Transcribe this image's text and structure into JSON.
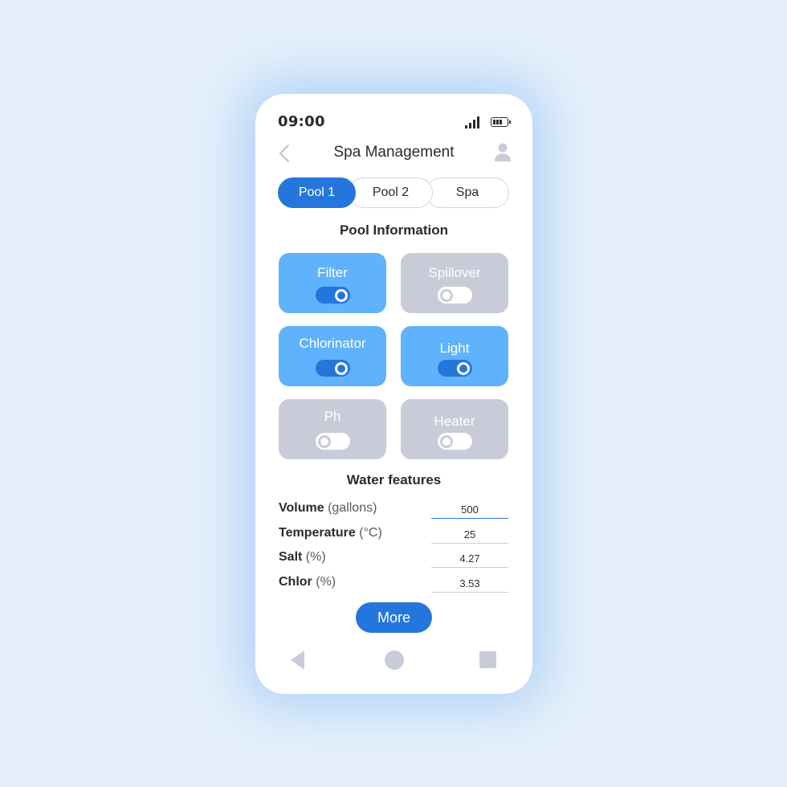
{
  "status_bar": {
    "time": "09:00",
    "icons": [
      "signal-icon",
      "battery-icon"
    ]
  },
  "header": {
    "title": "Spa Management",
    "back_icon": "chevron-left-icon",
    "profile_icon": "user-icon"
  },
  "tabs": [
    {
      "label": "Pool 1",
      "active": true
    },
    {
      "label": "Pool 2",
      "active": false
    },
    {
      "label": "Spa",
      "active": false
    }
  ],
  "pool_information": {
    "title": "Pool Information",
    "devices": [
      {
        "label": "Filter",
        "on": true
      },
      {
        "label": "Spillover",
        "on": false
      },
      {
        "label": "Chlorinator",
        "on": true
      },
      {
        "label": "Light",
        "on": true
      },
      {
        "label": "Ph",
        "on": false
      },
      {
        "label": "Heater",
        "on": false
      }
    ]
  },
  "water_features": {
    "title": "Water features",
    "rows": [
      {
        "label": "Volume",
        "unit": "(gallons)",
        "value": "500"
      },
      {
        "label": "Temperature",
        "unit": "(°C)",
        "value": "25"
      },
      {
        "label": "Salt",
        "unit": "(%)",
        "value": "4.27"
      },
      {
        "label": "Chlor",
        "unit": "(%)",
        "value": "3.53"
      }
    ]
  },
  "more_button": {
    "label": "More"
  },
  "nav_bar": {
    "icons": [
      "nav-back-icon",
      "nav-home-icon",
      "nav-recent-apps-icon"
    ]
  },
  "colors": {
    "accent": "#2476dd",
    "card_on": "#5fb2fc",
    "card_off": "#c9ccd8",
    "background": "#e5f0fa"
  }
}
